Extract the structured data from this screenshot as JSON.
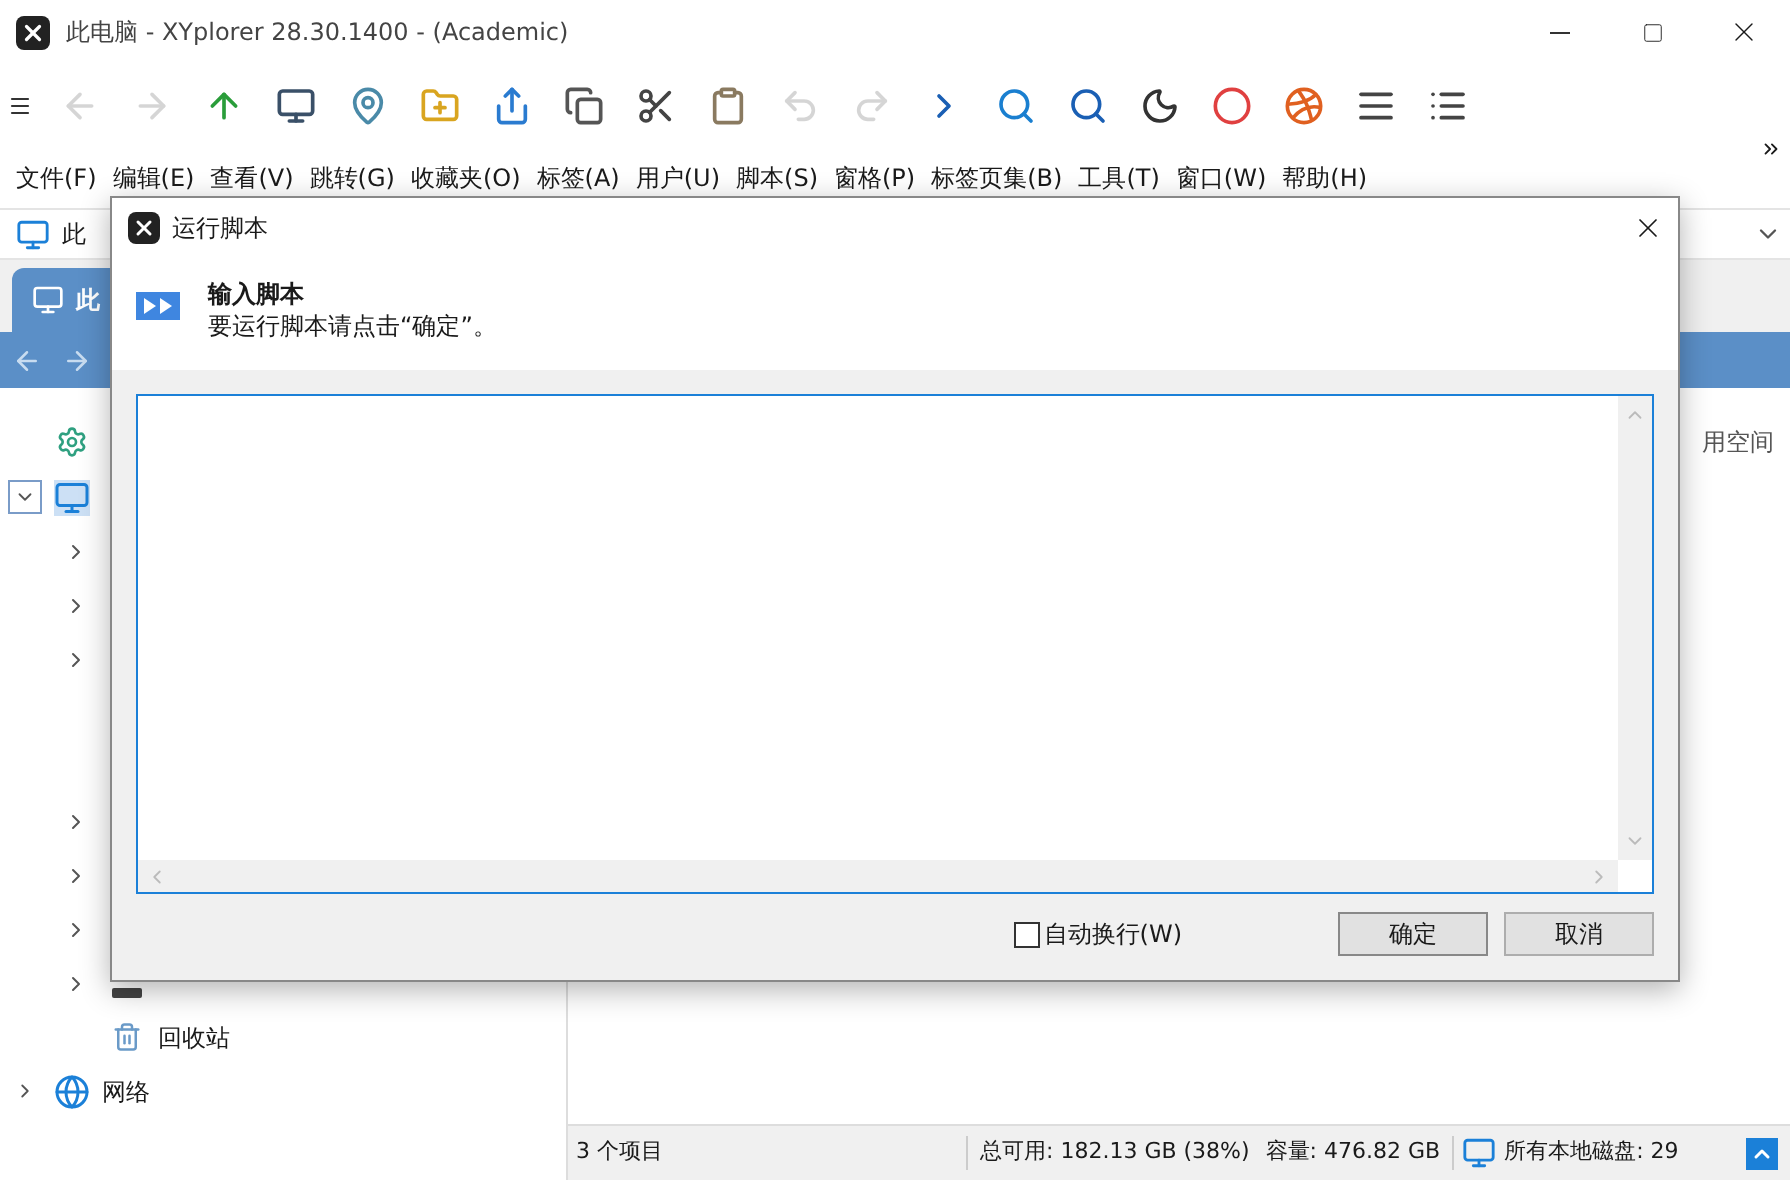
{
  "window": {
    "title": "此电脑 - XYplorer 28.30.1400 - (Academic)"
  },
  "toolbar": [
    {
      "disabled": false
    },
    {
      "disabled": true
    },
    {
      "disabled": true
    },
    {
      "disabled": false
    },
    {
      "disabled": false
    },
    {
      "disabled": false
    },
    {
      "disabled": false
    },
    {
      "disabled": false
    },
    {
      "disabled": false
    },
    {
      "disabled": false
    },
    {
      "disabled": false
    },
    {
      "disabled": true
    },
    {
      "disabled": true
    },
    {
      "disabled": false
    },
    {
      "disabled": false
    },
    {
      "disabled": false
    },
    {
      "disabled": false
    },
    {
      "disabled": false
    },
    {
      "disabled": false
    },
    {
      "disabled": false
    },
    {
      "disabled": false
    }
  ],
  "menu": [
    "文件(F)",
    "编辑(E)",
    "查看(V)",
    "跳转(G)",
    "收藏夹(O)",
    "标签(A)",
    "用户(U)",
    "脚本(S)",
    "窗格(P)",
    "标签页集(B)",
    "工具(T)",
    "窗口(W)",
    "帮助(H)"
  ],
  "address_bar": {
    "value": "此"
  },
  "tab": {
    "label": "此"
  },
  "tree": {
    "expanded": true,
    "selected": true,
    "children": [
      {
        "expandable": true
      },
      {
        "expandable": true
      },
      {
        "expandable": true
      },
      {
        "expandable": false
      },
      {
        "expandable": false
      },
      {
        "expandable": true
      },
      {
        "expandable": true
      },
      {
        "expandable": true
      },
      {
        "expandable": true,
        "kind": "drive"
      },
      {
        "label": "回收站",
        "expandable": false,
        "kind": "bin"
      }
    ]
  },
  "tree_root_2": {
    "label": "网络",
    "expanded": false
  },
  "file_list": {
    "column_header": "用空间"
  },
  "status_bar": {
    "items": "3 个项目",
    "free": "总可用: 182.13 GB (38%)",
    "capacity": "容量: 476.82 GB",
    "drives": "所有本地磁盘: 29"
  },
  "dialog": {
    "title": "运行脚本",
    "heading": "输入脚本",
    "instruction": "要运行脚本请点击“确定”。",
    "word_wrap": {
      "label": "自动换行(W)",
      "checked": false
    },
    "buttons": [
      {
        "label": "确定",
        "default": true
      },
      {
        "label": "取消",
        "default": false
      }
    ]
  }
}
